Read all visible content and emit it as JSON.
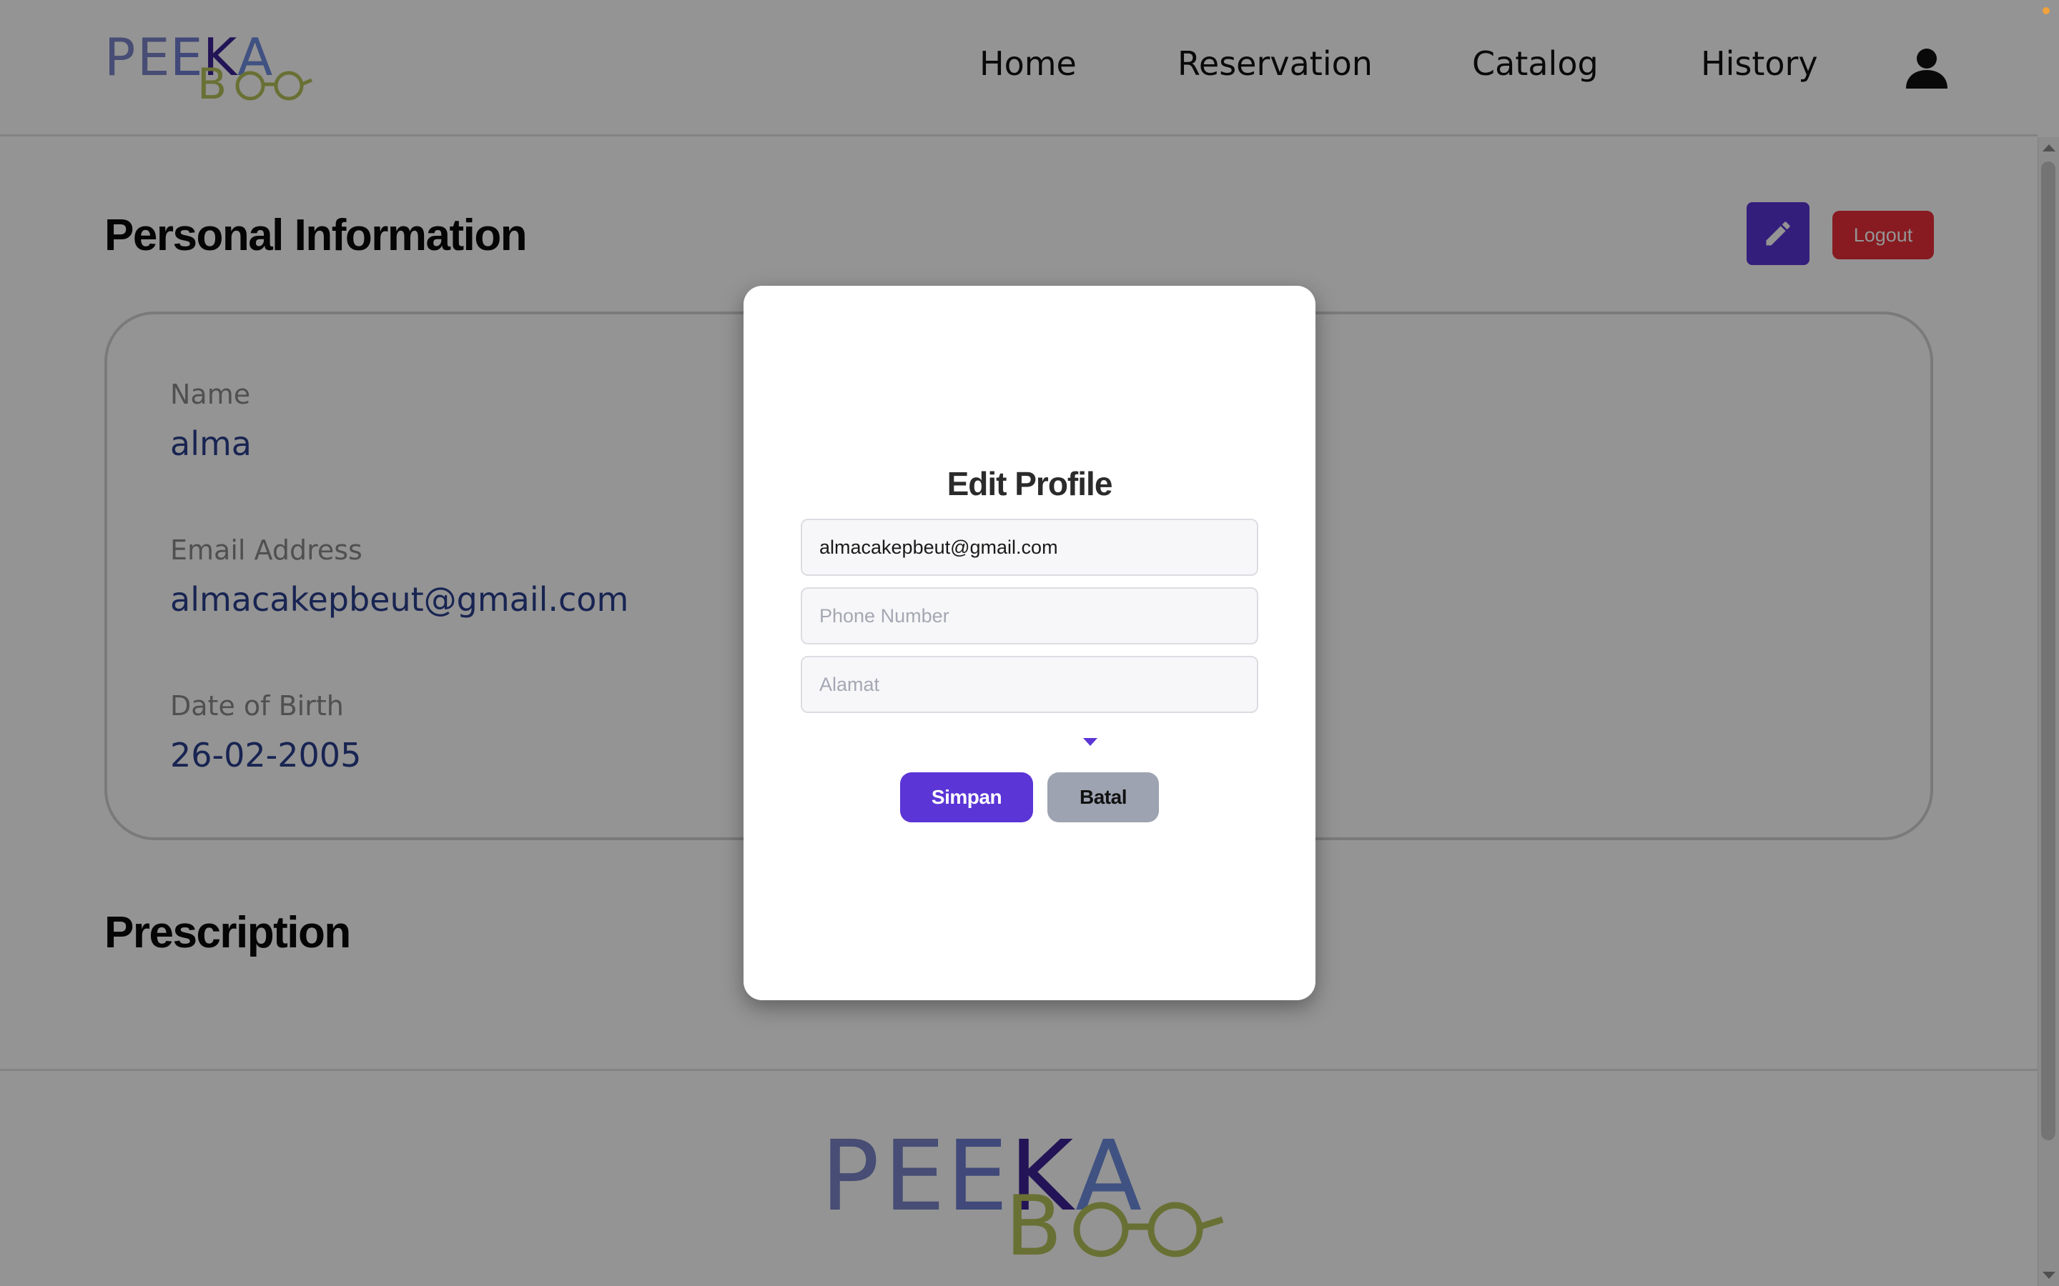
{
  "brand": {
    "logo_top": [
      "P",
      "E",
      "E",
      "K",
      "A"
    ],
    "logo_bottom": [
      "B",
      "O",
      "O"
    ],
    "colors": {
      "p": "#7b86c9",
      "e1": "#7b86c9",
      "e2": "#6f7fd0",
      "k": "#3b2494",
      "a": "#6f8ee0",
      "boo": "#b6c25a"
    }
  },
  "nav": {
    "home": "Home",
    "reservation": "Reservation",
    "catalog": "Catalog",
    "history": "History",
    "profile_icon": "user-icon"
  },
  "personal": {
    "title": "Personal Information",
    "edit_icon": "pencil-icon",
    "logout": "Logout",
    "fields": [
      {
        "label": "Name",
        "value": "alma"
      },
      {
        "label": "Email Address",
        "value": "almacakepbeut@gmail.com"
      },
      {
        "label": "Date of Birth",
        "value": "26-02-2005"
      }
    ]
  },
  "prescription": {
    "title": "Prescription"
  },
  "modal": {
    "title": "Edit Profile",
    "email_value": "almacakepbeut@gmail.com",
    "phone_placeholder": "Phone Number",
    "address_placeholder": "Alamat",
    "save": "Simpan",
    "cancel": "Batal"
  },
  "colors": {
    "accent": "#5b35d5",
    "danger": "#e8303a",
    "value_text": "#2a3f8d"
  }
}
